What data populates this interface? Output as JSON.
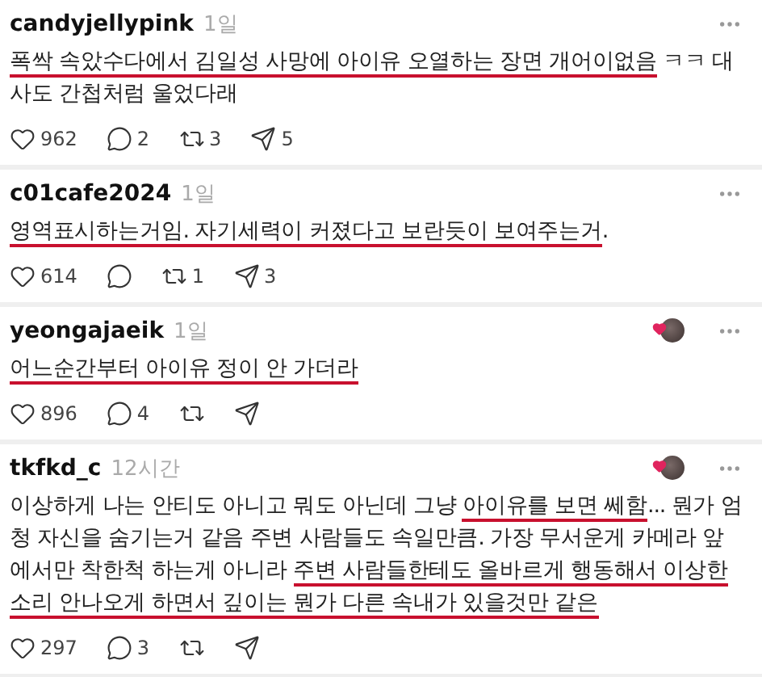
{
  "posts": [
    {
      "username": "candyjellypink",
      "time": "1일",
      "author_liked": false,
      "body": [
        {
          "text": "폭싹 속았수다에서 김일성 사망에 아이유 오열하는 장면 개어이없음",
          "underlined": true
        },
        {
          "text": " ㅋㅋ 대사도 간첩처럼 울었다래",
          "underlined": false
        }
      ],
      "stats": {
        "likes": "962",
        "replies": "2",
        "reposts": "3",
        "shares": "5"
      }
    },
    {
      "username": "c01cafe2024",
      "time": "1일",
      "author_liked": false,
      "body": [
        {
          "text": "영역표시하는거임. 자기세력이 커졌다고 보란듯이 보여주는거",
          "underlined": true
        },
        {
          "text": ".",
          "underlined": false
        }
      ],
      "stats": {
        "likes": "614",
        "reposts": "1",
        "shares": "3"
      }
    },
    {
      "username": "yeongajaeik",
      "time": "1일",
      "author_liked": true,
      "body": [
        {
          "text": "어느순간부터 아이유 정이 안 가더라",
          "underlined": true
        }
      ],
      "stats": {
        "likes": "896",
        "replies": "4"
      }
    },
    {
      "username": "tkfkd_c",
      "time": "12시간",
      "author_liked": true,
      "body": [
        {
          "text": "이상하게 나는 안티도 아니고 뭐도 아닌데 그냥 ",
          "underlined": false
        },
        {
          "text": "아이유를 보면 쎄함",
          "underlined": true
        },
        {
          "text": "... 뭔가 엄청 자신을 숨기는거 같음 주변 사람들도 속일만큼. 가장 무서운게 카메라 앞에서만 착한척 하는게 아니라 ",
          "underlined": false
        },
        {
          "text": "주변 사람들한테도 올바르게 행동해서 이상한 소리 안나오게 하면서 깊이는 뭔가 다른 속내가 있을것만 같은",
          "underlined": true
        }
      ],
      "stats": {
        "likes": "297",
        "replies": "3"
      }
    }
  ]
}
